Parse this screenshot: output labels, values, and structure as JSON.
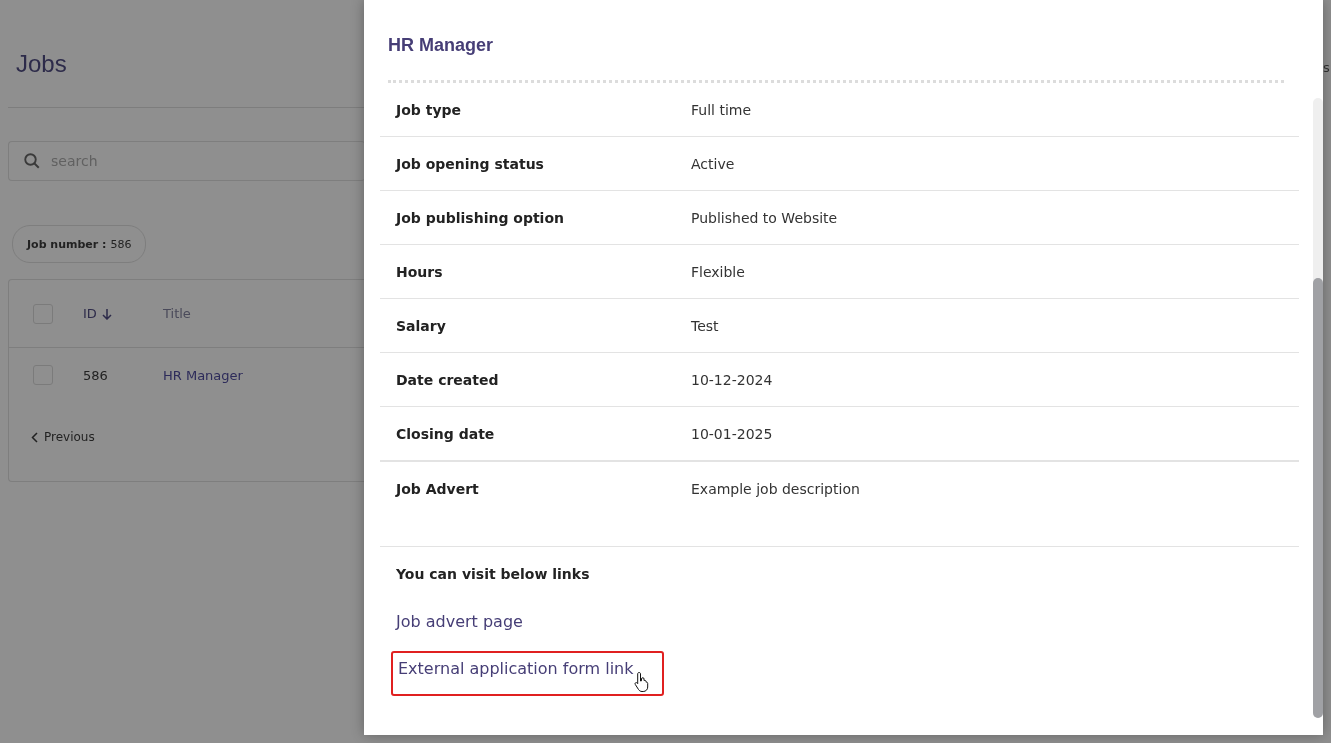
{
  "page": {
    "title": "Jobs",
    "search": {
      "placeholder": "search"
    },
    "filter_chip": {
      "label": "Job number :",
      "value": "586"
    },
    "table": {
      "columns": [
        {
          "label": "ID",
          "sorted": true
        },
        {
          "label": "Title",
          "sorted": false
        }
      ],
      "rows": [
        {
          "checked": false,
          "id": "586",
          "title": "HR Manager"
        }
      ],
      "header_checked": false
    },
    "pagination": {
      "previous": "Previous"
    },
    "edge_text": "s"
  },
  "modal": {
    "title": "HR Manager",
    "details": [
      {
        "label": "Job type",
        "value": "Full time"
      },
      {
        "label": "Job opening status",
        "value": "Active"
      },
      {
        "label": "Job publishing option",
        "value": "Published to Website"
      },
      {
        "label": "Hours",
        "value": "Flexible"
      },
      {
        "label": "Salary",
        "value": "Test"
      },
      {
        "label": "Date created",
        "value": "10-12-2024"
      },
      {
        "label": "Closing date",
        "value": "10-01-2025"
      },
      {
        "label": "Job Advert",
        "value": "Example job description"
      }
    ],
    "links_heading": "You can visit below links",
    "links": [
      {
        "label": "Job advert page",
        "highlighted": false
      },
      {
        "label": "External application form link",
        "highlighted": true
      }
    ]
  }
}
